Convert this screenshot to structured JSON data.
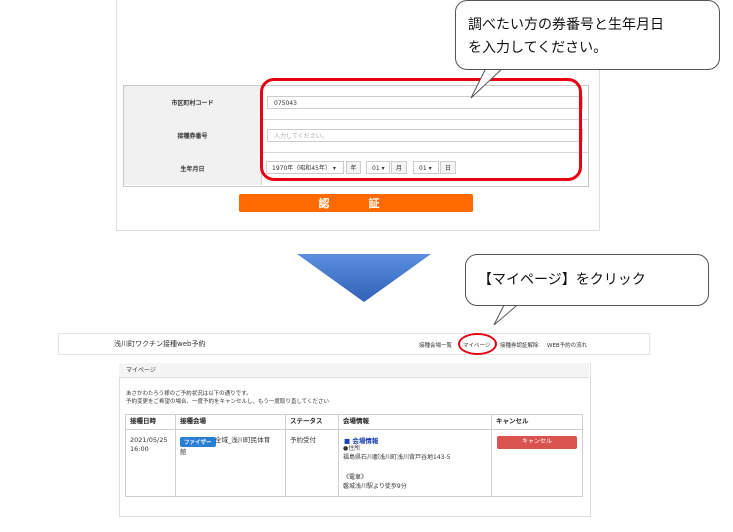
{
  "form": {
    "rows": [
      {
        "label": "市区町村コード",
        "value": "075043"
      },
      {
        "label": "接種券番号",
        "placeholder": "入力してください。"
      },
      {
        "label": "生年月日"
      }
    ],
    "birth": {
      "year": "1970年（昭和45年）",
      "year_unit": "年",
      "month": "01",
      "month_unit": "月",
      "day": "01",
      "day_unit": "日"
    },
    "submit_label": "認　証"
  },
  "callout1": {
    "line1": "調べたい方の券番号と生年月日",
    "line2": "を入力してください。"
  },
  "callout2": {
    "text": "【マイページ】をクリック"
  },
  "header": {
    "site_title": "浅川町ワクチン接種web予約",
    "nav": [
      "接種会場一覧",
      "マイページ",
      "接種券認証解除",
      "WEB予約の流れ"
    ]
  },
  "mypage": {
    "title": "マイページ",
    "intro1": "あさかわたろう様のご予約状況は以下の通りです。",
    "intro2": "予約変更をご希望の場合、一度予約をキャンセルし、もう一度取り直してください",
    "columns": [
      "接種日時",
      "接種会場",
      "ステータス",
      "会場情報",
      "キャンセル"
    ],
    "row": {
      "date": "2021/05/25",
      "time": "16:00",
      "badge": "ファイザー",
      "venue1": "全域_浅川町民体育",
      "venue2": "館",
      "status": "予約受付",
      "info_title": "■ 会場情報",
      "info_addr_label": "●住所",
      "info_addr": "福島県石川郡浅川町浅川背戸谷地143-5",
      "info_train_label": "《電車》",
      "info_train": "磐城浅川駅より徒歩9分",
      "cancel_label": "キャンセル"
    }
  },
  "colors": {
    "accent": "#ff6a00",
    "highlight": "#e60012",
    "arrow": "#3a73c9",
    "cancel": "#d9534f",
    "badge": "#2b7fd3"
  }
}
